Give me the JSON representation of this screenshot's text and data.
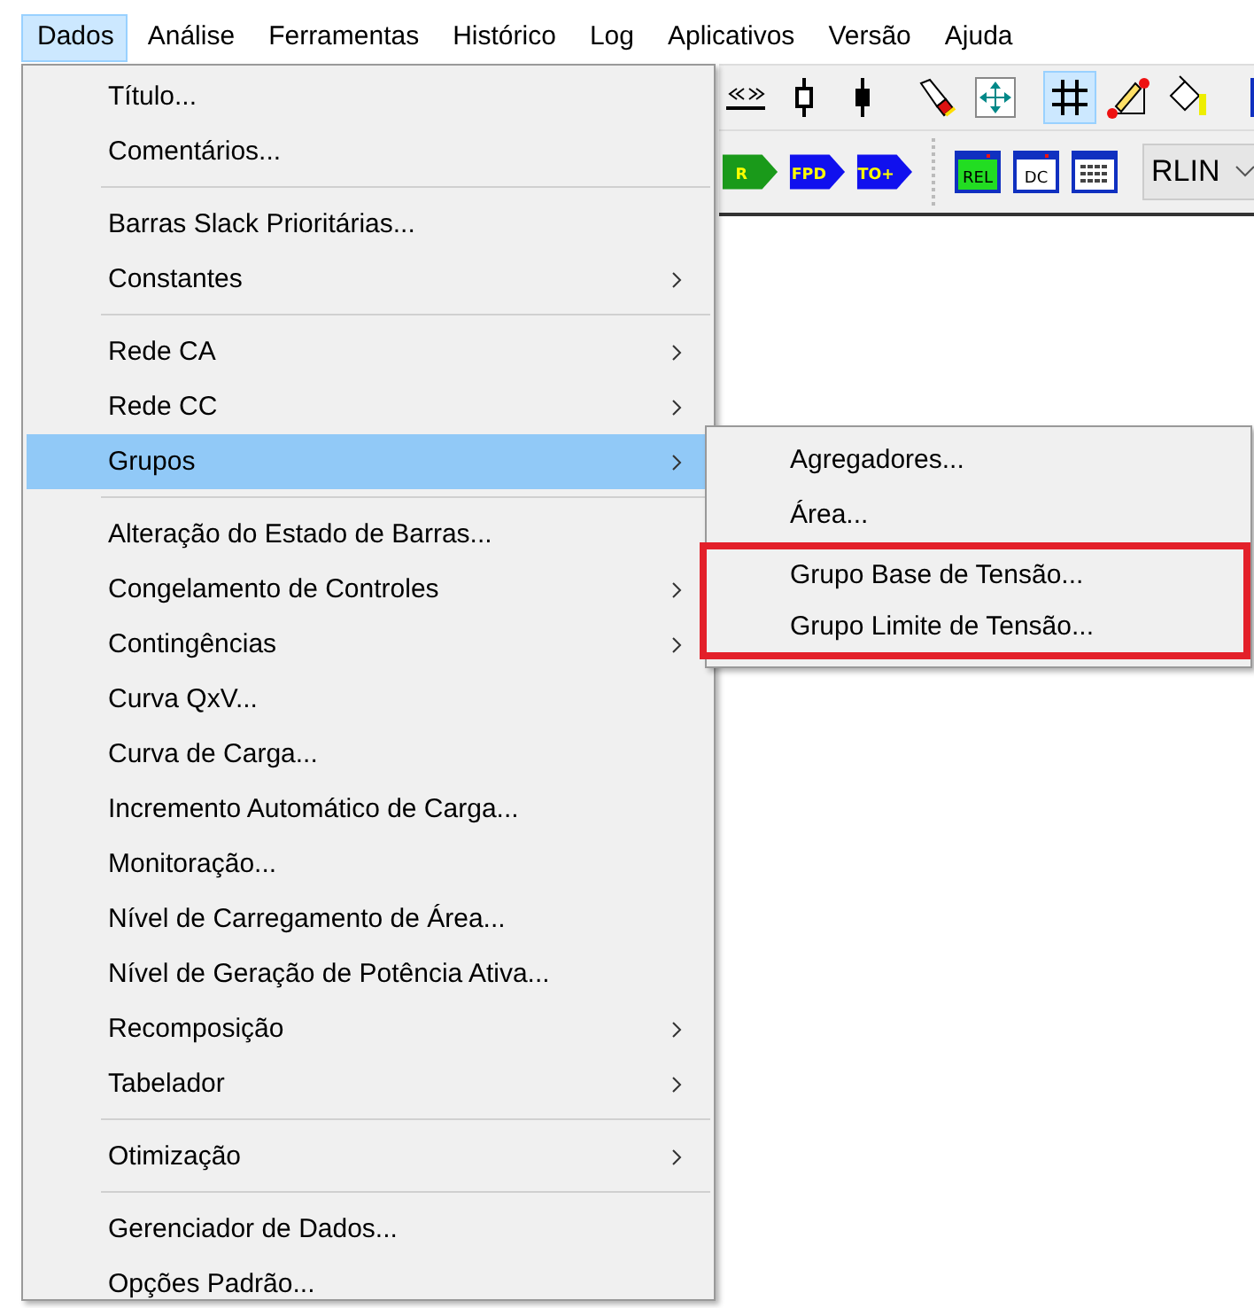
{
  "menubar": [
    {
      "label": "Dados",
      "selected": true
    },
    {
      "label": "Análise",
      "selected": false
    },
    {
      "label": "Ferramentas",
      "selected": false
    },
    {
      "label": "Histórico",
      "selected": false
    },
    {
      "label": "Log",
      "selected": false
    },
    {
      "label": "Aplicativos",
      "selected": false
    },
    {
      "label": "Versão",
      "selected": false
    },
    {
      "label": "Ajuda",
      "selected": false
    }
  ],
  "toolbar_top": [
    {
      "kind": "chevrons",
      "pressed": false
    },
    {
      "kind": "node-open",
      "pressed": false
    },
    {
      "kind": "node-filled",
      "pressed": false
    },
    {
      "kind": "sep"
    },
    {
      "kind": "flashlight",
      "pressed": false
    },
    {
      "kind": "move",
      "pressed": false
    },
    {
      "kind": "sep"
    },
    {
      "kind": "grid",
      "pressed": true
    },
    {
      "kind": "pen",
      "pressed": false
    },
    {
      "kind": "bucket",
      "pressed": false
    },
    {
      "kind": "sep"
    },
    {
      "kind": "window",
      "pressed": false
    }
  ],
  "toolbar_bottom": [
    {
      "kind": "run",
      "label": "R"
    },
    {
      "kind": "run",
      "label": "FPD"
    },
    {
      "kind": "run",
      "label": "TO+"
    },
    {
      "kind": "grip"
    },
    {
      "kind": "report",
      "label": "REL",
      "color": "#22dd22"
    },
    {
      "kind": "report",
      "label": "DC",
      "color": "#ffffff"
    },
    {
      "kind": "table"
    },
    {
      "kind": "sep"
    },
    {
      "kind": "combo",
      "value": "RLIN"
    }
  ],
  "dropdown": [
    {
      "kind": "item",
      "label": "Título...",
      "submenu": false,
      "selected": false
    },
    {
      "kind": "item",
      "label": "Comentários...",
      "submenu": false,
      "selected": false
    },
    {
      "kind": "separator"
    },
    {
      "kind": "item",
      "label": "Barras Slack Prioritárias...",
      "submenu": false,
      "selected": false
    },
    {
      "kind": "item",
      "label": "Constantes",
      "submenu": true,
      "selected": false
    },
    {
      "kind": "separator"
    },
    {
      "kind": "item",
      "label": "Rede CA",
      "submenu": true,
      "selected": false
    },
    {
      "kind": "item",
      "label": "Rede CC",
      "submenu": true,
      "selected": false
    },
    {
      "kind": "item",
      "label": "Grupos",
      "submenu": true,
      "selected": true
    },
    {
      "kind": "separator"
    },
    {
      "kind": "item",
      "label": "Alteração do Estado de Barras...",
      "submenu": false,
      "selected": false
    },
    {
      "kind": "item",
      "label": "Congelamento de Controles",
      "submenu": true,
      "selected": false
    },
    {
      "kind": "item",
      "label": "Contingências",
      "submenu": true,
      "selected": false
    },
    {
      "kind": "item",
      "label": "Curva QxV...",
      "submenu": false,
      "selected": false
    },
    {
      "kind": "item",
      "label": "Curva de Carga...",
      "submenu": false,
      "selected": false
    },
    {
      "kind": "item",
      "label": "Incremento Automático de Carga...",
      "submenu": false,
      "selected": false
    },
    {
      "kind": "item",
      "label": "Monitoração...",
      "submenu": false,
      "selected": false
    },
    {
      "kind": "item",
      "label": "Nível de Carregamento de Área...",
      "submenu": false,
      "selected": false
    },
    {
      "kind": "item",
      "label": "Nível de Geração de Potência Ativa...",
      "submenu": false,
      "selected": false
    },
    {
      "kind": "item",
      "label": "Recomposição",
      "submenu": true,
      "selected": false
    },
    {
      "kind": "item",
      "label": "Tabelador",
      "submenu": true,
      "selected": false
    },
    {
      "kind": "separator"
    },
    {
      "kind": "item",
      "label": "Otimização",
      "submenu": true,
      "selected": false
    },
    {
      "kind": "separator"
    },
    {
      "kind": "item",
      "label": "Gerenciador de Dados...",
      "submenu": false,
      "selected": false
    },
    {
      "kind": "item",
      "label": "Opções Padrão...",
      "submenu": false,
      "selected": false
    }
  ],
  "submenu": [
    {
      "label": "Agregadores...",
      "annotated": false
    },
    {
      "label": "Área...",
      "annotated": false
    },
    {
      "label": "Grupo Base de Tensão...",
      "annotated": true
    },
    {
      "label": "Grupo Limite de Tensão...",
      "annotated": true
    }
  ]
}
